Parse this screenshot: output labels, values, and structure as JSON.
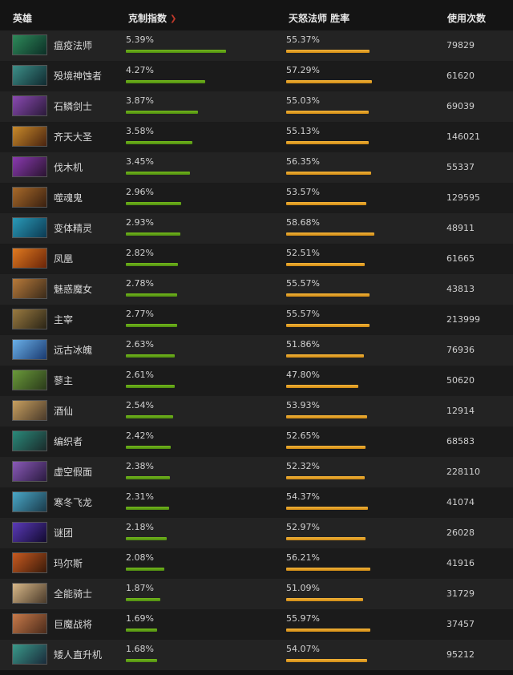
{
  "header": {
    "hero": "英雄",
    "index": "克制指数",
    "winrate": "天怒法师 胜率",
    "count": "使用次数"
  },
  "icons": {
    "sort": "chevron-down-icon"
  },
  "colors": {
    "index_bar": "#63a515",
    "win_bar": "#e5a229",
    "sort_icon": "#c0392b"
  },
  "rows": [
    {
      "name": "瘟疫法师",
      "index": "5.39%",
      "win": "55.37%",
      "count": "79829",
      "index_level": 5.39,
      "win_level": 55.37,
      "avatar": [
        "#2e8a5a",
        "#0c2f26"
      ]
    },
    {
      "name": "殁境神蚀者",
      "index": "4.27%",
      "win": "57.29%",
      "count": "61620",
      "index_level": 4.27,
      "win_level": 57.29,
      "avatar": [
        "#3d8f88",
        "#102a30"
      ]
    },
    {
      "name": "石鳞剑士",
      "index": "3.87%",
      "win": "55.03%",
      "count": "69039",
      "index_level": 3.87,
      "win_level": 55.03,
      "avatar": [
        "#8a4ab2",
        "#2b1a3a"
      ]
    },
    {
      "name": "齐天大圣",
      "index": "3.58%",
      "win": "55.13%",
      "count": "146021",
      "index_level": 3.58,
      "win_level": 55.13,
      "avatar": [
        "#c98a2a",
        "#4a2410"
      ]
    },
    {
      "name": "伐木机",
      "index": "3.45%",
      "win": "56.35%",
      "count": "55337",
      "index_level": 3.45,
      "win_level": 56.35,
      "avatar": [
        "#8a3ab0",
        "#2a1430"
      ]
    },
    {
      "name": "噬魂鬼",
      "index": "2.96%",
      "win": "53.57%",
      "count": "129595",
      "index_level": 2.96,
      "win_level": 53.57,
      "avatar": [
        "#a86a2a",
        "#3a2010"
      ]
    },
    {
      "name": "变体精灵",
      "index": "2.93%",
      "win": "58.68%",
      "count": "48911",
      "index_level": 2.93,
      "win_level": 58.68,
      "avatar": [
        "#2a9ab8",
        "#0c3a52"
      ]
    },
    {
      "name": "凤凰",
      "index": "2.82%",
      "win": "52.51%",
      "count": "61665",
      "index_level": 2.82,
      "win_level": 52.51,
      "avatar": [
        "#e07a20",
        "#6a2408"
      ]
    },
    {
      "name": "魅惑魔女",
      "index": "2.78%",
      "win": "55.57%",
      "count": "43813",
      "index_level": 2.78,
      "win_level": 55.57,
      "avatar": [
        "#b87a3a",
        "#3a2a1a"
      ]
    },
    {
      "name": "主宰",
      "index": "2.77%",
      "win": "55.57%",
      "count": "213999",
      "index_level": 2.77,
      "win_level": 55.57,
      "avatar": [
        "#9a7a40",
        "#2a2416"
      ]
    },
    {
      "name": "远古冰魄",
      "index": "2.63%",
      "win": "51.86%",
      "count": "76936",
      "index_level": 2.63,
      "win_level": 51.86,
      "avatar": [
        "#6ab0e8",
        "#1a3a70"
      ]
    },
    {
      "name": "蓼主",
      "index": "2.61%",
      "win": "47.80%",
      "count": "50620",
      "index_level": 2.61,
      "win_level": 47.8,
      "avatar": [
        "#6a9a3a",
        "#2a3a1a"
      ]
    },
    {
      "name": "酒仙",
      "index": "2.54%",
      "win": "53.93%",
      "count": "12914",
      "index_level": 2.54,
      "win_level": 53.93,
      "avatar": [
        "#c8a060",
        "#4a3a2a"
      ]
    },
    {
      "name": "编织者",
      "index": "2.42%",
      "win": "52.65%",
      "count": "68583",
      "index_level": 2.42,
      "win_level": 52.65,
      "avatar": [
        "#2a8a7a",
        "#1a2a2a"
      ]
    },
    {
      "name": "虚空假面",
      "index": "2.38%",
      "win": "52.32%",
      "count": "228110",
      "index_level": 2.38,
      "win_level": 52.32,
      "avatar": [
        "#8a5ab8",
        "#2a1a40"
      ]
    },
    {
      "name": "寒冬飞龙",
      "index": "2.31%",
      "win": "54.37%",
      "count": "41074",
      "index_level": 2.31,
      "win_level": 54.37,
      "avatar": [
        "#4aa8c8",
        "#1a3a4a"
      ]
    },
    {
      "name": "谜团",
      "index": "2.18%",
      "win": "52.97%",
      "count": "26028",
      "index_level": 2.18,
      "win_level": 52.97,
      "avatar": [
        "#5a3ab8",
        "#120a30"
      ]
    },
    {
      "name": "玛尔斯",
      "index": "2.08%",
      "win": "56.21%",
      "count": "41916",
      "index_level": 2.08,
      "win_level": 56.21,
      "avatar": [
        "#c85a20",
        "#3a1a0a"
      ]
    },
    {
      "name": "全能骑士",
      "index": "1.87%",
      "win": "51.09%",
      "count": "31729",
      "index_level": 1.87,
      "win_level": 51.09,
      "avatar": [
        "#d8b888",
        "#4a3a2a"
      ]
    },
    {
      "name": "巨魔战将",
      "index": "1.69%",
      "win": "55.97%",
      "count": "37457",
      "index_level": 1.69,
      "win_level": 55.97,
      "avatar": [
        "#c87a4a",
        "#4a2a1a"
      ]
    },
    {
      "name": "矮人直升机",
      "index": "1.68%",
      "win": "54.07%",
      "count": "95212",
      "index_level": 1.68,
      "win_level": 54.07,
      "avatar": [
        "#3a9a8a",
        "#1a2a3a"
      ]
    }
  ]
}
